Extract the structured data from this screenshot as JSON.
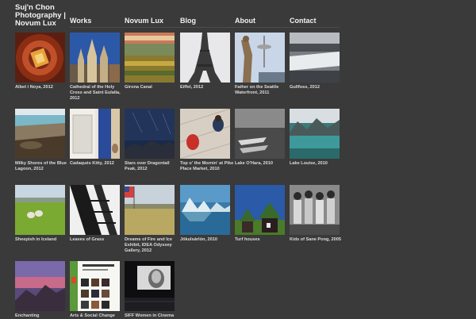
{
  "site": {
    "title": "Suj'n Chon Photography | Novum Lux"
  },
  "nav": {
    "items": [
      {
        "label": "Works"
      },
      {
        "label": "Novum Lux"
      },
      {
        "label": "Blog"
      },
      {
        "label": "About"
      },
      {
        "label": "Contact"
      }
    ]
  },
  "gallery": {
    "items": [
      {
        "caption": "Albet i Noya, 2012",
        "icon": "spiral-staircase-photo"
      },
      {
        "caption": "Cathedral of the Holy Cross and Saint Eulalia, 2012",
        "icon": "cathedral-photo"
      },
      {
        "caption": "Girona Canal",
        "icon": "canal-photo"
      },
      {
        "caption": "Eiffel, 2012",
        "icon": "eiffel-tower-photo"
      },
      {
        "caption": "Father on the Seattle Waterfront, 2011",
        "icon": "statue-photo"
      },
      {
        "caption": "Gullfoss, 2012",
        "icon": "waterfall-photo"
      },
      {
        "caption": "Milky Shores of the Blue Lagoon, 2012",
        "icon": "lagoon-shore-photo"
      },
      {
        "caption": "Cadaqués Kitty, 2012",
        "icon": "cat-door-photo"
      },
      {
        "caption": "Stars over Dragontail Peak, 2012",
        "icon": "night-sky-photo"
      },
      {
        "caption": "Top o' the Mornin' at Pike Place Market, 2010",
        "icon": "pike-place-photo"
      },
      {
        "caption": "Lake O'Hara, 2010",
        "icon": "lake-boats-photo"
      },
      {
        "caption": "Lake Louise, 2010",
        "icon": "lake-mountains-photo"
      },
      {
        "caption": "Sheepish in Iceland",
        "icon": "sheep-field-photo"
      },
      {
        "caption": "Leaves of Grass",
        "icon": "stairs-shadow-photo"
      },
      {
        "caption": "Dreams of Fire and Ice Exhibit, IDEA Odyssey Gallery, 2012",
        "icon": "flag-field-photo"
      },
      {
        "caption": "Jökulsárlón, 2010",
        "icon": "glacier-lagoon-photo"
      },
      {
        "caption": "Turf houses",
        "icon": "turf-houses-photo"
      },
      {
        "caption": "Kids of Sane Pong, 2005",
        "icon": "children-photo"
      },
      {
        "caption": "Enchanting",
        "icon": "sunset-mountain-photo"
      },
      {
        "caption": "Arts & Social Change",
        "icon": "poster-photo"
      },
      {
        "caption": "SIFF Women in Cinema",
        "icon": "cinema-screen-photo"
      }
    ]
  }
}
